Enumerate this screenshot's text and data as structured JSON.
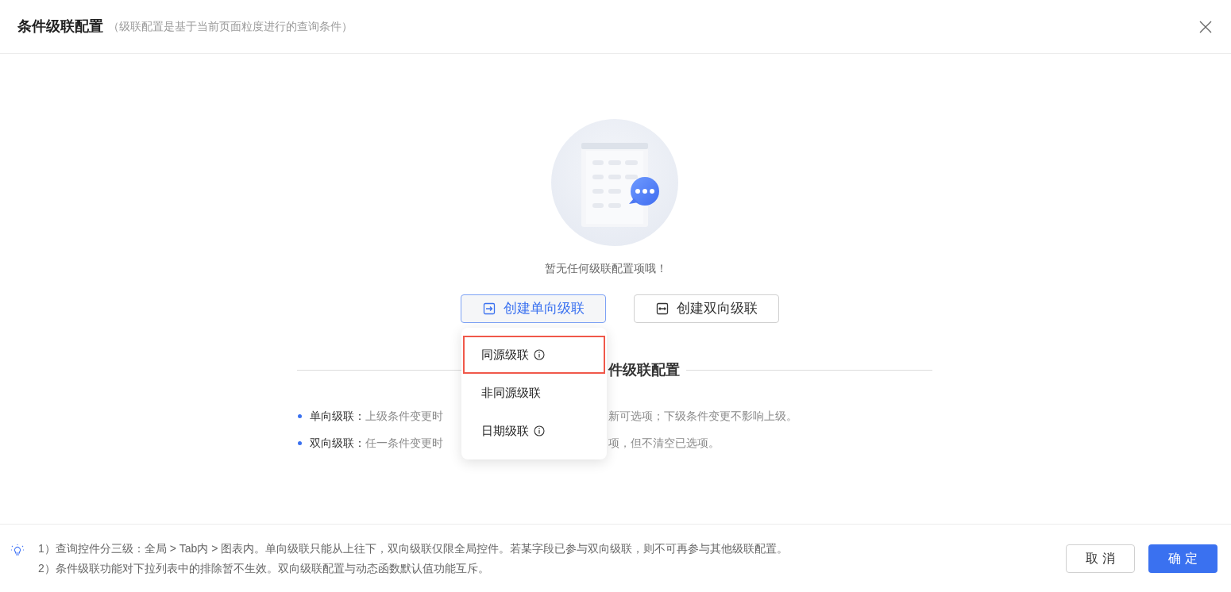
{
  "dialog": {
    "title": "条件级联配置",
    "subtitle": "（级联配置是基于当前页面粒度进行的查询条件）"
  },
  "empty_text": "暂无任何级联配置项哦！",
  "create_buttons": [
    {
      "kind": "one_way",
      "label": "创建单向级联",
      "active": true
    },
    {
      "kind": "two_way",
      "label": "创建双向级联",
      "active": false
    }
  ],
  "dropdown": {
    "items": [
      {
        "label": "同源级联",
        "info": true,
        "selected": true
      },
      {
        "label": "非同源级联",
        "info": false,
        "selected": false
      },
      {
        "label": "日期级联",
        "info": true,
        "selected": false
      }
    ]
  },
  "section_heading": "件级联配置",
  "notes": [
    {
      "term": "单向级联：",
      "text_before": "上级条件变更时",
      "text_after": "新可选项；下级条件变更不影响上级。"
    },
    {
      "term": "双向级联：",
      "text_before": "任一条件变更时",
      "text_after": "项，但不清空已选项。"
    }
  ],
  "footer": {
    "tips": [
      "1）查询控件分三级：全局 > Tab内 > 图表内。单向级联只能从上往下，双向级联仅限全局控件。若某字段已参与双向级联，则不可再参与其他级联配置。",
      "2）条件级联功能对下拉列表中的排除暂不生效。双向级联配置与动态函数默认值功能互斥。"
    ],
    "buttons": [
      {
        "kind": "secondary",
        "label": "取 消"
      },
      {
        "kind": "primary",
        "label": "确 定"
      }
    ]
  }
}
